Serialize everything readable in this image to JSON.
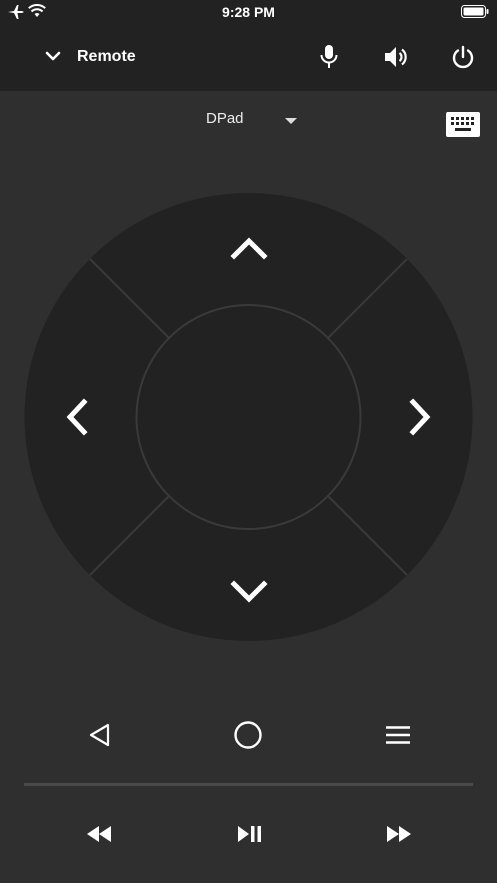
{
  "status_bar": {
    "time": "9:28 PM"
  },
  "header": {
    "title": "Remote"
  },
  "dpad_selector": {
    "label": "DPad"
  },
  "colors": {
    "background": "#2f2f2f",
    "header_bg": "#222222",
    "dpad_fill": "#222222",
    "icon": "#ffffff"
  },
  "icons": {
    "header": [
      "chevron-down-icon",
      "microphone-icon",
      "volume-icon",
      "power-icon"
    ],
    "navigation": [
      "back-icon",
      "home-icon",
      "menu-icon"
    ],
    "media": [
      "rewind-icon",
      "play-pause-icon",
      "fast-forward-icon"
    ]
  }
}
